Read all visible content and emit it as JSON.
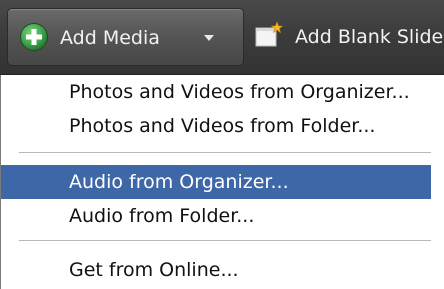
{
  "toolbar": {
    "add_media_label": "Add Media",
    "add_blank_slide_label": "Add Blank Slide",
    "icons": {
      "add": "plus-circle-icon",
      "dropdown": "chevron-down-icon",
      "blank_slide": "blank-slide-icon"
    },
    "colors": {
      "toolbar_bg": "#3c3c3c",
      "plus_green": "#3fa34d",
      "text": "#f2f2f2"
    }
  },
  "menu": {
    "items": [
      {
        "label": "Photos and Videos from Organizer..."
      },
      {
        "label": "Photos and Videos from Folder..."
      },
      {
        "label": "Audio from Organizer..."
      },
      {
        "label": "Audio from Folder..."
      },
      {
        "label": "Get from Online..."
      }
    ],
    "highlight_color": "#3e67a8"
  }
}
